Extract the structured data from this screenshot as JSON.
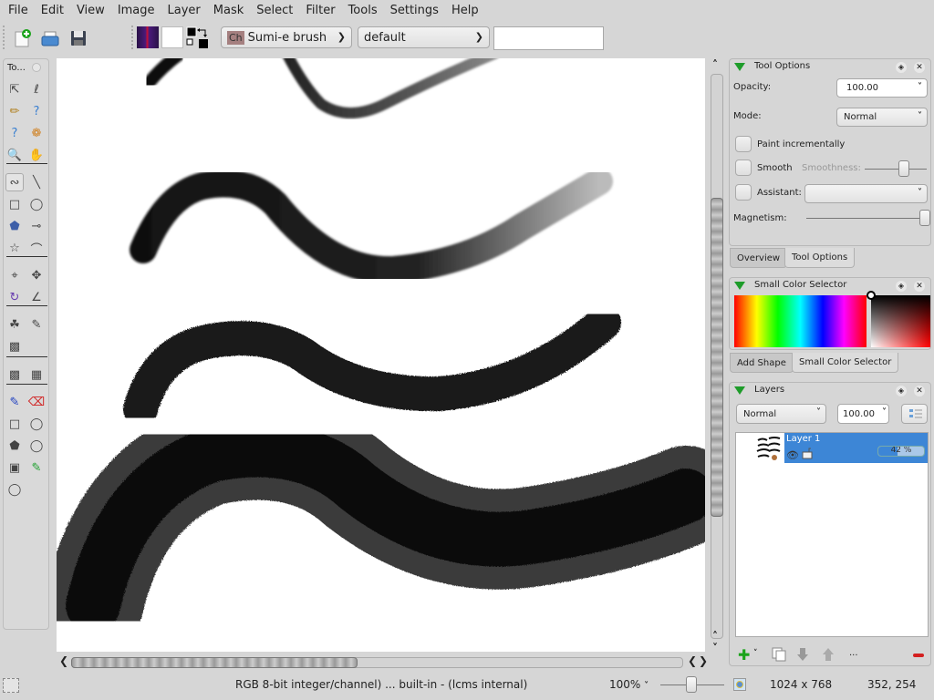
{
  "menubar": {
    "items": [
      "File",
      "Edit",
      "View",
      "Image",
      "Layer",
      "Mask",
      "Select",
      "Filter",
      "Tools",
      "Settings",
      "Help"
    ]
  },
  "toolbar": {
    "new_icon": "new-document-icon",
    "print_icon": "print-icon",
    "save_icon": "save-icon",
    "gradient_preview_icon": "gradient-preview",
    "pattern_preview_icon": "pattern-preview",
    "fg_bg_icon": "fg-bg-color-icon",
    "brush_preset": {
      "badge": "Ch",
      "label": "Sumi-e brush"
    },
    "preset_variant": "default",
    "text_field_value": ""
  },
  "toolbox": {
    "title": "To...",
    "tools": [
      "select-shapes-tool",
      "calligraphy-tool",
      "freehand-brush-tool",
      "unknown-tool-1",
      "unknown-tool-2",
      "color-fill-tool",
      "zoom-tool",
      "pan-tool",
      "freehand-path-tool",
      "line-tool",
      "rectangle-tool",
      "ellipse-tool",
      "polygon-tool",
      "polyline-tool",
      "star-tool",
      "bezier-curve-tool",
      "crop-tool",
      "move-tool",
      "transform-tool",
      "perspective-tool",
      "fill-tool",
      "color-picker-tool",
      "gradient-tool",
      "perspective-grid-tool",
      "grid-tool",
      "brush-selection-tool",
      "eraser-selection-tool",
      "rectangular-selection-tool",
      "elliptical-selection-tool",
      "polygonal-selection-tool",
      "outline-selection-tool",
      "contiguous-selection-tool",
      "similar-color-selection-tool",
      "bezier-selection-tool"
    ]
  },
  "tool_options": {
    "title": "Tool Options",
    "opacity_label": "Opacity:",
    "opacity_value": "100.00",
    "mode_label": "Mode:",
    "mode_value": "Normal",
    "paint_incrementally_label": "Paint incrementally",
    "paint_incrementally_checked": false,
    "smooth_label": "Smooth",
    "smooth_checked": false,
    "smoothness_label": "Smoothness:",
    "smoothness_level": 0.7,
    "assistant_label": "Assistant:",
    "assistant_checked": false,
    "assistant_value": "",
    "magnetism_label": "Magnetism:",
    "magnetism_level": 1.0
  },
  "tabs_top": [
    "Overview",
    "Tool Options"
  ],
  "color_selector": {
    "title": "Small Color Selector",
    "selected_hue": "#ff0000"
  },
  "tabs_mid": [
    "Add Shape",
    "Small Color Selector"
  ],
  "layers": {
    "title": "Layers",
    "blend_mode": "Normal",
    "opacity": "100.00",
    "items": [
      {
        "name": "Layer 1",
        "opacity_label": "42 %",
        "opacity_value": 42,
        "visible": true,
        "locked": false
      }
    ],
    "footer": {
      "add_icon": "add-layer-icon",
      "duplicate_icon": "duplicate-layer-icon",
      "move_down_icon": "move-down-icon",
      "move_up_icon": "move-up-icon",
      "more_label": "...",
      "remove_icon": "remove-layer-icon"
    }
  },
  "statusbar": {
    "selection_icon": "selection-icon",
    "color_profile": "RGB 8-bit integer/channel) ... built-in - (lcms internal)",
    "zoom": "100%",
    "image_size": "1024 x 768",
    "cursor_position": "352, 254"
  },
  "scrollbars": {
    "vertical_position": 0.22,
    "horizontal_position": 0.0
  }
}
